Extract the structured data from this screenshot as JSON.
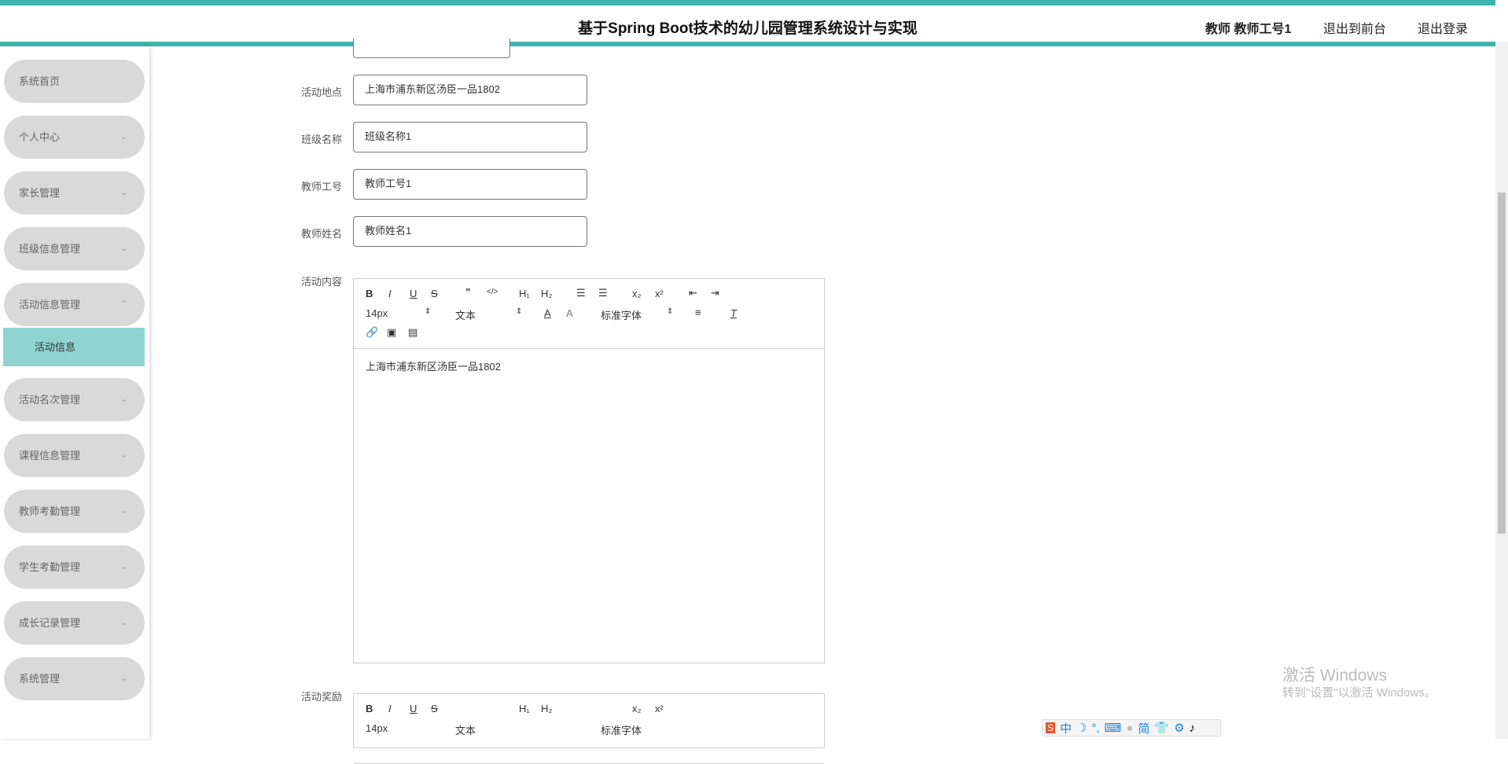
{
  "header": {
    "title": "基于Spring Boot技术的幼儿园管理系统设计与实现",
    "user": "教师 教师工号1",
    "to_front": "退出到前台",
    "logout": "退出登录"
  },
  "sidebar": {
    "items": [
      {
        "label": "系统首页",
        "chev": ""
      },
      {
        "label": "个人中心",
        "chev": "⌄"
      },
      {
        "label": "家长管理",
        "chev": "⌄"
      },
      {
        "label": "班级信息管理",
        "chev": "⌄"
      },
      {
        "label": "活动信息管理",
        "chev": "⌃"
      },
      {
        "label": "活动名次管理",
        "chev": "⌄"
      },
      {
        "label": "课程信息管理",
        "chev": "⌄"
      },
      {
        "label": "教师考勤管理",
        "chev": "⌄"
      },
      {
        "label": "学生考勤管理",
        "chev": "⌄"
      },
      {
        "label": "成长记录管理",
        "chev": "⌄"
      },
      {
        "label": "系统管理",
        "chev": "⌄"
      }
    ],
    "sub": "活动信息"
  },
  "form": {
    "location_label": "活动地点",
    "location": "上海市浦东新区汤臣一品1802",
    "class_label": "班级名称",
    "class": "班级名称1",
    "teacher_id_label": "教师工号",
    "teacher_id": "教师工号1",
    "teacher_name_label": "教师姓名",
    "teacher_name": "教师姓名1",
    "content_label": "活动内容",
    "content": "上海市浦东新区汤臣一品1802",
    "reward_label": "活动奖励"
  },
  "toolbar": {
    "size": "14px",
    "para": "文本",
    "font": "标准字体"
  },
  "watermark": {
    "line1": "激活 Windows",
    "line2": "转到\"设置\"以激活 Windows。"
  },
  "ime": {
    "lang": "中",
    "simp": "简"
  }
}
